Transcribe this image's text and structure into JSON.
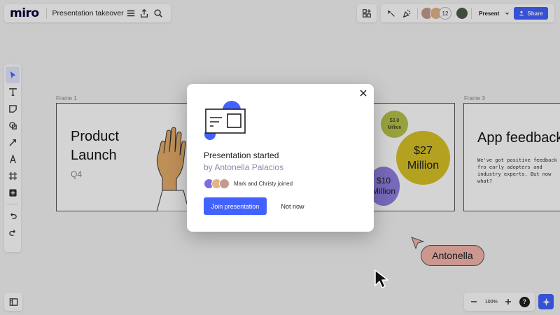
{
  "app": {
    "logo": "miro",
    "board_title": "Presentation takeover"
  },
  "header": {
    "collab_count": "12",
    "present_label": "Present",
    "share_label": "Share"
  },
  "frames": [
    {
      "label": "Frame 1",
      "title_line1": "Product",
      "title_line2": "Launch",
      "subtitle": "Q4"
    },
    {
      "label": "Frame 3",
      "title": "App feedback",
      "body": "We've got positive feedback fro early adopters and industry experts. But now what?"
    }
  ],
  "bubbles": [
    {
      "line1": "$3,8",
      "line2": "Million",
      "color": "#b9c24a"
    },
    {
      "line1": "$27",
      "line2": "Million",
      "color": "#d9c227"
    },
    {
      "line1": "$10",
      "line2": "Million",
      "color": "#8f80e0"
    }
  ],
  "cursor_name": "Antonella",
  "zoom": {
    "value": "100%"
  },
  "modal": {
    "title": "Presentation started",
    "subtitle": "by Antonella Palacios",
    "joined_text": "Mark and Christy joined",
    "join_label": "Join presentation",
    "notnow_label": "Not now"
  },
  "colors": {
    "accent": "#4262ff",
    "cursor_tag": "#f5b6ab"
  }
}
